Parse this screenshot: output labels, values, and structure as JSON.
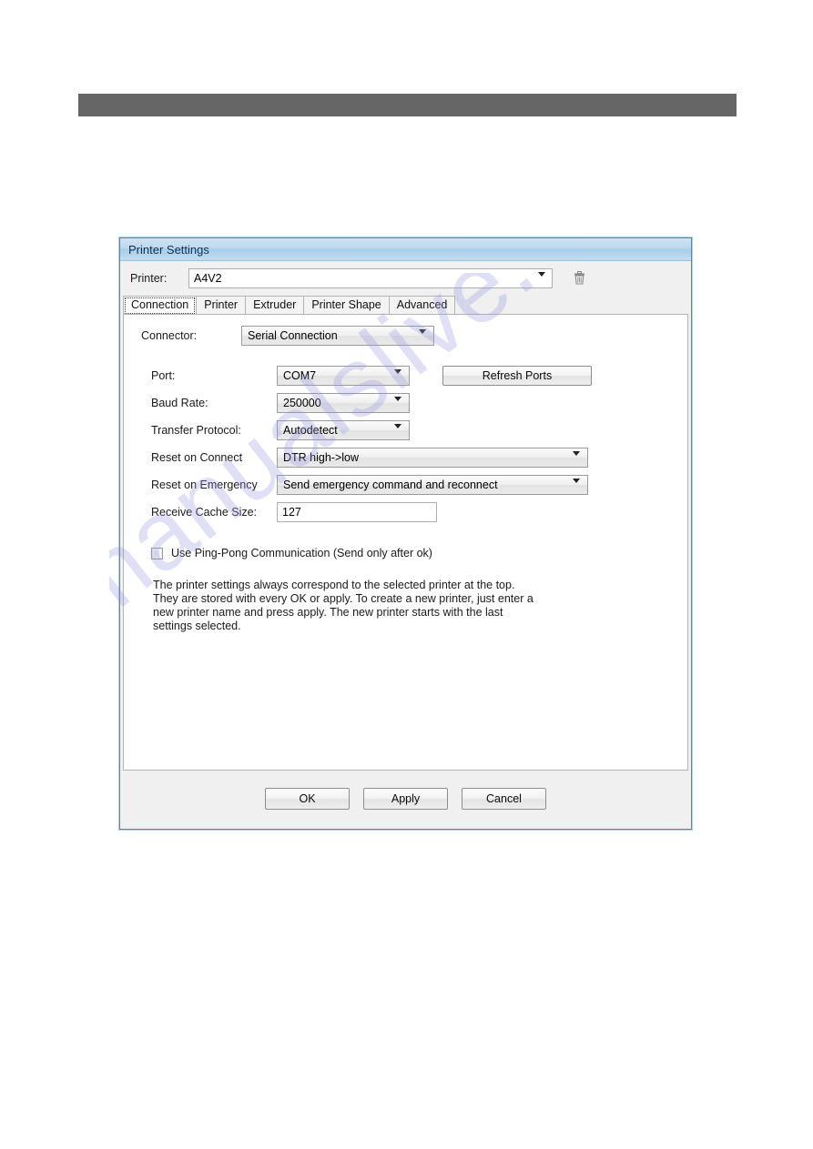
{
  "page": {
    "header_band_color": "#666666",
    "watermark_text": "manualslive.com"
  },
  "dialog": {
    "title": "Printer Settings",
    "accent_border_color": "#4c8ea8",
    "printer_selector": {
      "label": "Printer:",
      "value": "A4V2",
      "delete_icon": "trash-icon",
      "dropdown_icon": "chevron-down-icon"
    },
    "tabs": [
      {
        "label": "Connection",
        "selected": true
      },
      {
        "label": "Printer",
        "selected": false
      },
      {
        "label": "Extruder",
        "selected": false
      },
      {
        "label": "Printer Shape",
        "selected": false
      },
      {
        "label": "Advanced",
        "selected": false
      }
    ],
    "connection_tab": {
      "connector": {
        "label": "Connector:",
        "value": "Serial Connection"
      },
      "fields": [
        {
          "label": "Port:",
          "value": "COM7",
          "type": "combo"
        },
        {
          "label": "Baud Rate:",
          "value": "250000",
          "type": "combo"
        },
        {
          "label": "Transfer Protocol:",
          "value": "Autodetect",
          "type": "combo"
        },
        {
          "label": "Reset on Connect",
          "value": "DTR high->low",
          "type": "combo"
        },
        {
          "label": "Reset on Emergency",
          "value": "Send emergency command and reconnect",
          "type": "combo"
        },
        {
          "label": "Receive Cache Size:",
          "value": "127",
          "type": "text"
        }
      ],
      "refresh_button": "Refresh Ports",
      "ping_pong": {
        "label": "Use Ping-Pong Communication (Send only after ok)",
        "checked": false
      },
      "description": "The printer settings always correspond to the selected printer at the top. They are stored with every OK or apply. To create a new printer, just enter a new printer name and press apply. The new printer starts with the last settings selected."
    },
    "footer_buttons": [
      {
        "label": "OK"
      },
      {
        "label": "Apply"
      },
      {
        "label": "Cancel"
      }
    ]
  }
}
